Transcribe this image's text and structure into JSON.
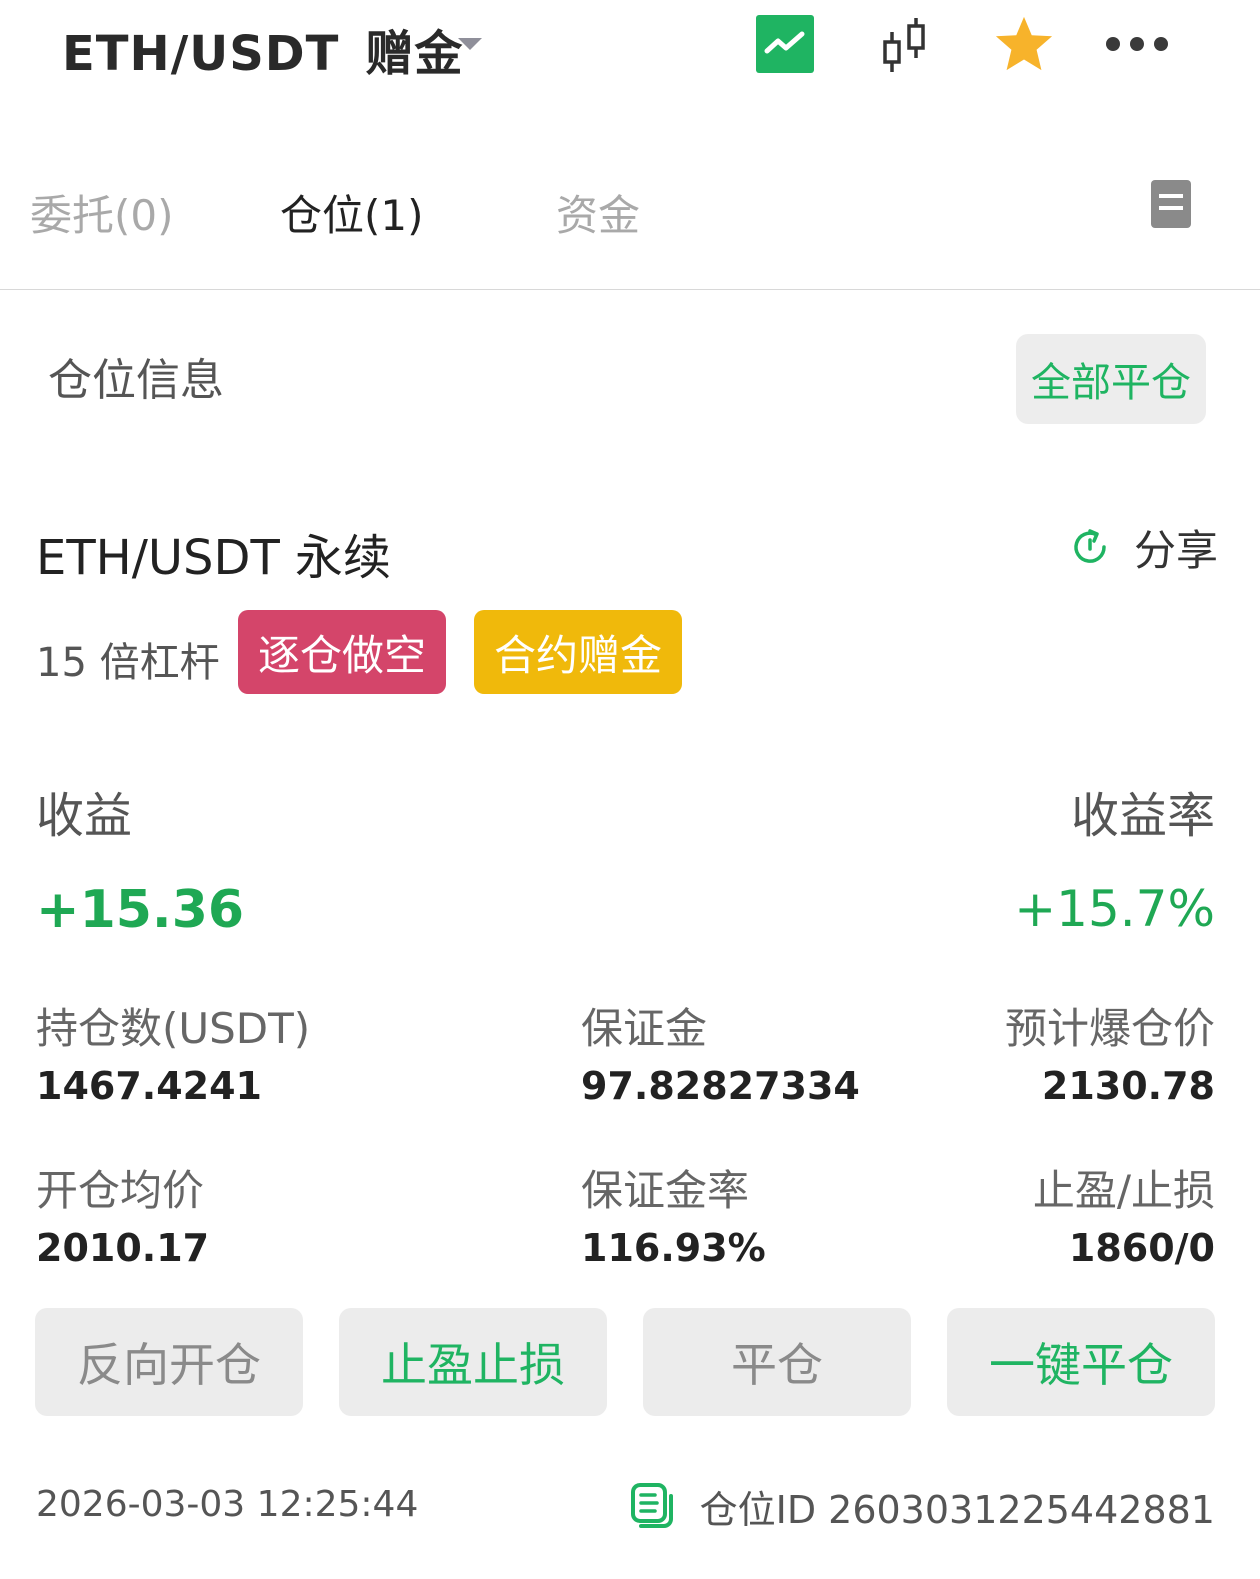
{
  "header": {
    "pair": "ETH/USDT",
    "mode": "赠金",
    "icons": [
      "chart-icon",
      "candlestick-icon",
      "star-icon",
      "more-icon"
    ],
    "accent_color": "#1fb462",
    "star_color": "#f7b32b"
  },
  "tabs": [
    {
      "label": "委托(0)",
      "active": false
    },
    {
      "label": "仓位(1)",
      "active": true
    },
    {
      "label": "资金",
      "active": false
    }
  ],
  "position_section": {
    "title": "仓位信息",
    "close_all_label": "全部平仓"
  },
  "position": {
    "contract": "ETH/USDT 永续",
    "share_label": "分享",
    "leverage": "15 倍杠杆",
    "side_tag": "逐仓做空",
    "bonus_tag": "合约赠金",
    "pnl_label": "收益",
    "pnl_value": "+15.36",
    "roe_label": "收益率",
    "roe_value": "+15.7%",
    "metrics": {
      "size_label": "持仓数(USDT)",
      "size_value": "1467.4241",
      "margin_label": "保证金",
      "margin_value": "97.82827334",
      "liq_label": "预计爆仓价",
      "liq_value": "2130.78",
      "entry_label": "开仓均价",
      "entry_value": "2010.17",
      "margin_ratio_label": "保证金率",
      "margin_ratio_value": "116.93%",
      "tpsl_label": "止盈/止损",
      "tpsl_value": "1860/0"
    },
    "actions": {
      "reverse": "反向开仓",
      "tpsl": "止盈止损",
      "close": "平仓",
      "one_click_close": "一键平仓"
    },
    "timestamp": "2026-03-03 12:25:44",
    "position_id": "仓位ID 2603031225442881",
    "colors": {
      "profit": "#1fa854",
      "short_tag": "#d4456a",
      "bonus_tag": "#f0b90b"
    }
  }
}
